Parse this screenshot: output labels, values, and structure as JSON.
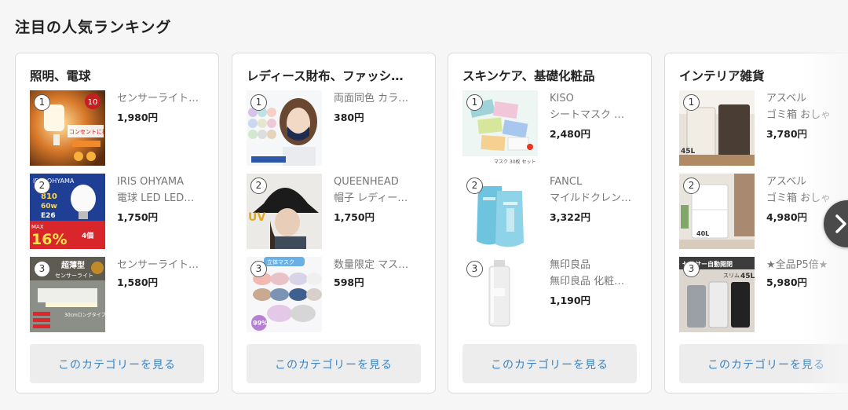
{
  "section": {
    "title": "注目の人気ランキング"
  },
  "cards": [
    {
      "title": "照明、電球",
      "more_label": "このカテゴリーを見る",
      "items": [
        {
          "rank": "1",
          "name": "センサーライト…",
          "name2": "",
          "price": "1,980円"
        },
        {
          "rank": "2",
          "name": "IRIS OHYAMA",
          "name2": "電球 LED LED…",
          "price": "1,750円"
        },
        {
          "rank": "3",
          "name": "センサーライト…",
          "name2": "",
          "price": "1,580円"
        }
      ]
    },
    {
      "title": "レディース財布、ファッシ…",
      "more_label": "このカテゴリーを見る",
      "items": [
        {
          "rank": "1",
          "name": "両面同色 カラ…",
          "name2": "",
          "price": "380円"
        },
        {
          "rank": "2",
          "name": "QUEENHEAD",
          "name2": "帽子 レディー…",
          "price": "1,750円"
        },
        {
          "rank": "3",
          "name": "数量限定 マス…",
          "name2": "",
          "price": "598円"
        }
      ]
    },
    {
      "title": "スキンケア、基礎化粧品",
      "more_label": "このカテゴリーを見る",
      "items": [
        {
          "rank": "1",
          "name": "KISO",
          "name2": "シートマスク …",
          "price": "2,480円"
        },
        {
          "rank": "2",
          "name": "FANCL",
          "name2": "マイルドクレン…",
          "price": "3,322円"
        },
        {
          "rank": "3",
          "name": "無印良品",
          "name2": "無印良品 化粧…",
          "price": "1,190円"
        }
      ]
    },
    {
      "title": "インテリア雑貨",
      "more_label": "このカテゴリーを見る",
      "items": [
        {
          "rank": "1",
          "name": "アスベル",
          "name2": "ゴミ箱 おしゃ",
          "price": "3,780円"
        },
        {
          "rank": "2",
          "name": "アスベル",
          "name2": "ゴミ箱 おしゃ",
          "price": "4,980円"
        },
        {
          "rank": "3",
          "name": "★全品P5倍★",
          "name2": "",
          "price": "5,980円"
        }
      ]
    }
  ],
  "thumb_text": {
    "c1i1": "コンセントに挿すだけ!",
    "c1i1_badge": "10",
    "c1i2_brand": "IRIS OHYAMA",
    "c1i2_watts": "810",
    "c1i2_w60": "60w",
    "c1i2_e26": "E26",
    "c1i2_max": "MAX",
    "c1i2_pct": "16%",
    "c1i2_pack": "4個",
    "c1i3_title": "超薄型",
    "c1i3_sub": "センサーライト",
    "c1i3_len": "30cmロングタイプ",
    "c2i3_title": "立体マスク",
    "c2i3_pct": "99%",
    "c2i2_uv": "UV",
    "c3i1_caption": "マスク 30枚 セット",
    "c4i1_size": "45L",
    "c4i2_size": "40L",
    "c4i3_title": "センサー自動開閉",
    "c4i3_size": "45L",
    "c4i3_tag": "スリム"
  },
  "nav": {
    "next_icon": "chevron-right-icon"
  },
  "colors": {
    "link": "#3a84c2",
    "button_bg": "#ededed",
    "nav_bg": "#4a4a4a"
  }
}
